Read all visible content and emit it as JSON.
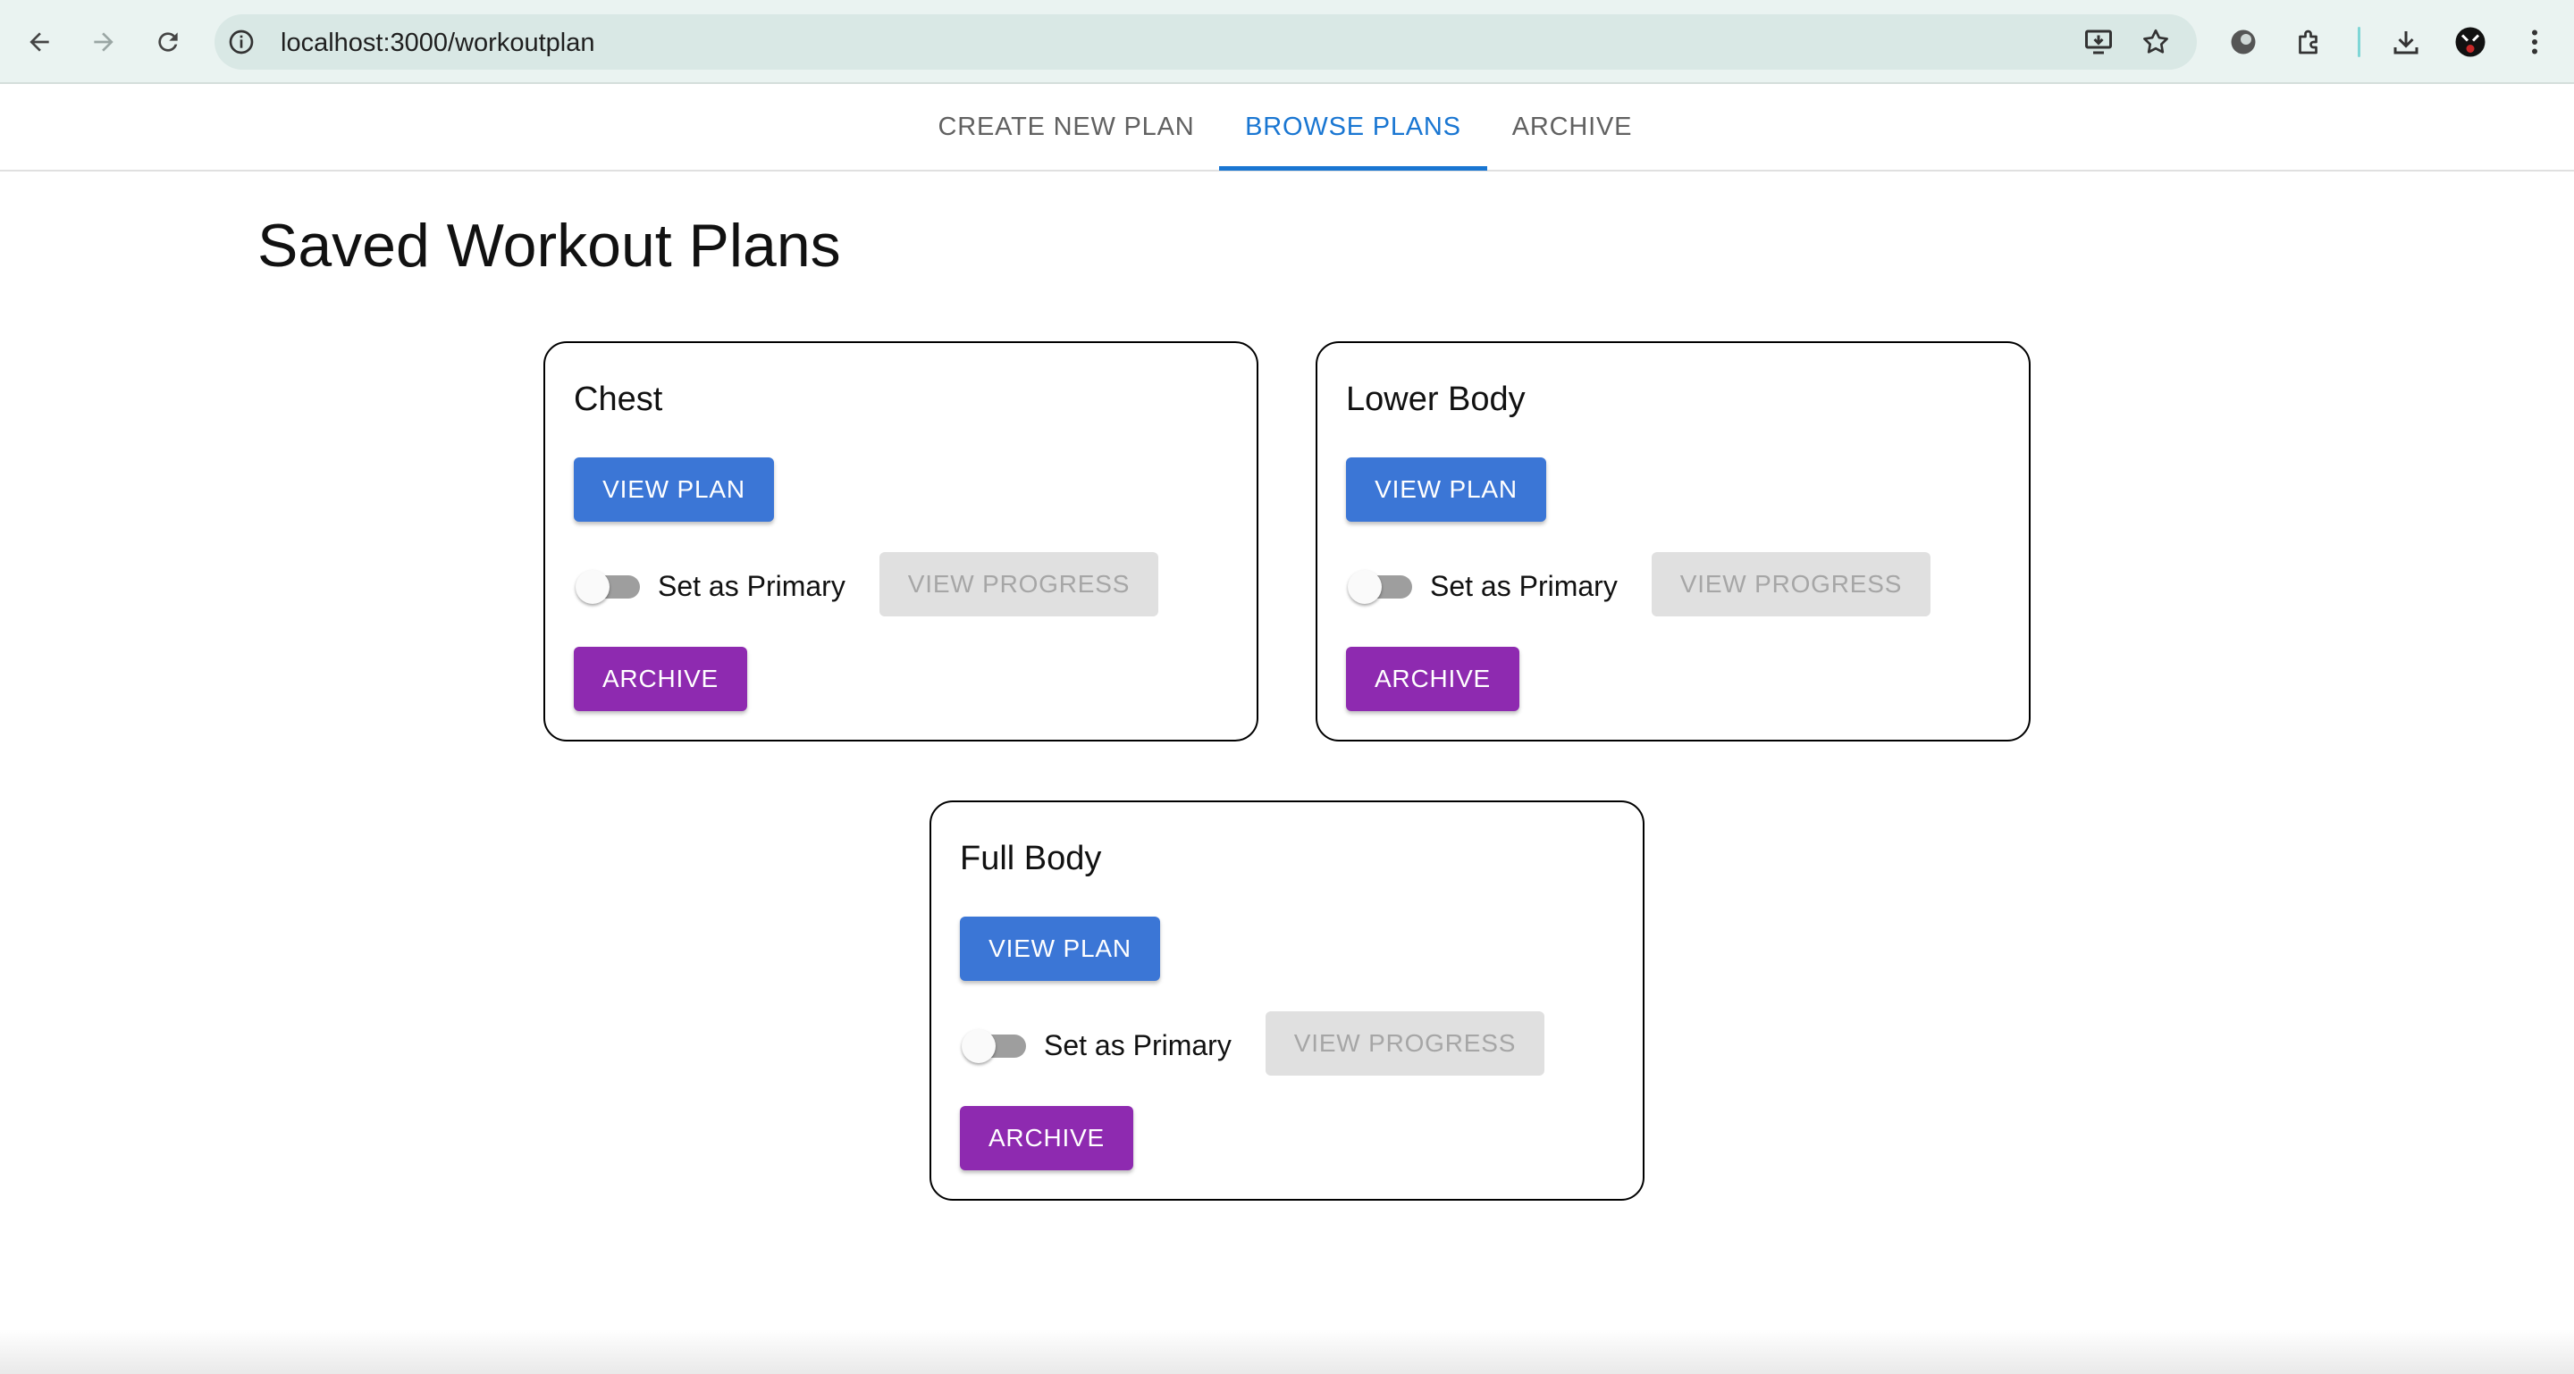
{
  "browser": {
    "url": "localhost:3000/workoutplan",
    "icons": [
      "back-arrow-icon",
      "forward-arrow-icon",
      "reload-icon",
      "site-info-icon",
      "install-app-icon",
      "bookmark-star-icon",
      "extension-puzzle-icon",
      "download-icon",
      "profile-avatar-icon",
      "kebab-menu-icon"
    ]
  },
  "tabs": [
    {
      "label": "CREATE NEW PLAN",
      "active": false
    },
    {
      "label": "BROWSE PLANS",
      "active": true
    },
    {
      "label": "ARCHIVE",
      "active": false
    }
  ],
  "page": {
    "title": "Saved Workout Plans"
  },
  "plans": [
    {
      "name": "Chest",
      "view_label": "VIEW PLAN",
      "primary_label": "Set as Primary",
      "progress_label": "VIEW PROGRESS",
      "archive_label": "ARCHIVE",
      "is_primary": false
    },
    {
      "name": "Lower Body",
      "view_label": "VIEW PLAN",
      "primary_label": "Set as Primary",
      "progress_label": "VIEW PROGRESS",
      "archive_label": "ARCHIVE",
      "is_primary": false
    },
    {
      "name": "Full Body",
      "view_label": "VIEW PLAN",
      "primary_label": "Set as Primary",
      "progress_label": "VIEW PROGRESS",
      "archive_label": "ARCHIVE",
      "is_primary": false
    }
  ],
  "colors": {
    "primary": "#3b76d6",
    "secondary": "#8e2ab0",
    "tab_active": "#1976d2",
    "disabled_bg": "#e0e0e0",
    "disabled_text": "#a6a6a6"
  }
}
